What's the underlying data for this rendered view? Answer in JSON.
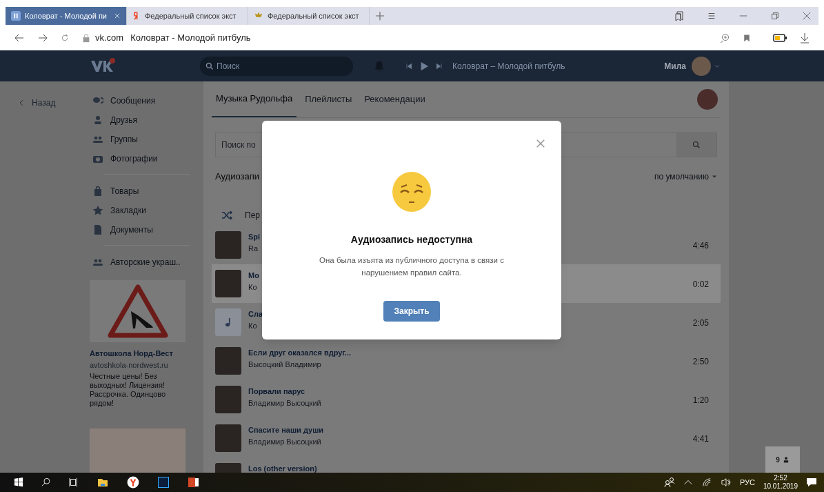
{
  "browser": {
    "tabs": [
      {
        "title": "Коловрат - Молодой пи",
        "selected": true,
        "kind": "vk"
      },
      {
        "title": "Федеральный список экст",
        "selected": false,
        "kind": "yandex"
      },
      {
        "title": "Федеральный список экст",
        "selected": false,
        "kind": "emblem"
      }
    ],
    "domain": "vk.com",
    "page_title": "Коловрат - Молодой питбуль"
  },
  "header": {
    "search_placeholder": "Поиск",
    "now_playing": "Коловрат – Молодой питбуль",
    "user": "Мила"
  },
  "back_link": "Назад",
  "sidebar": {
    "groups": [
      [
        {
          "label": "Сообщения",
          "kind": "messages"
        },
        {
          "label": "Друзья",
          "kind": "friend"
        },
        {
          "label": "Группы",
          "kind": "group"
        },
        {
          "label": "Фотографии",
          "kind": "camera"
        }
      ],
      [
        {
          "label": "Товары",
          "kind": "bag"
        },
        {
          "label": "Закладки",
          "kind": "star"
        },
        {
          "label": "Документы",
          "kind": "doc"
        }
      ],
      [
        {
          "label": "Авторские украш..",
          "kind": "group"
        }
      ]
    ]
  },
  "ad": {
    "title": "Автошкола Норд-Вест",
    "url": "avtoshkola-nordwest.ru",
    "text": "Честные цены! Без выходных! Лицензия! Рассрочка. Одинцово рядом!"
  },
  "music": {
    "tabs": [
      {
        "label": "Музыка Рудольфа",
        "selected": true
      },
      {
        "label": "Плейлисты",
        "selected": false
      },
      {
        "label": "Рекомендации",
        "selected": false
      }
    ],
    "search_placeholder": "Поиск по",
    "heading": "Аудиозапи",
    "sort": "по умолчанию",
    "shuffle": "Пер",
    "tracks": [
      {
        "title": "Spi",
        "artist": "Ra",
        "duration": "4:46",
        "current": false,
        "kind": "photo"
      },
      {
        "title": "Мо",
        "artist": "Ко",
        "duration": "0:02",
        "current": true,
        "kind": "photo"
      },
      {
        "title": "Сла",
        "artist": "Ко",
        "duration": "2:05",
        "current": false,
        "kind": "note"
      },
      {
        "title": "Если друг оказался вдруг...",
        "artist": "Высоцкий Владимир",
        "duration": "2:50",
        "current": false,
        "kind": "photo"
      },
      {
        "title": "Порвали парус",
        "artist": "Владимир Высоцкий",
        "duration": "1:20",
        "current": false,
        "kind": "photo"
      },
      {
        "title": "Спасите наши души",
        "artist": "Владимир Высоцкий",
        "duration": "4:41",
        "current": false,
        "kind": "photo"
      },
      {
        "title": "Los (other version)",
        "current": false,
        "kind": "photo"
      }
    ]
  },
  "chat_badge": "9",
  "modal": {
    "title": "Аудиозапись недоступна",
    "text": "Она была изъята из публичного доступа в связи с нарушением правил сайта.",
    "button": "Закрыть"
  },
  "taskbar": {
    "language": "РУС",
    "time": "2:52",
    "date": "10.01.2019"
  }
}
